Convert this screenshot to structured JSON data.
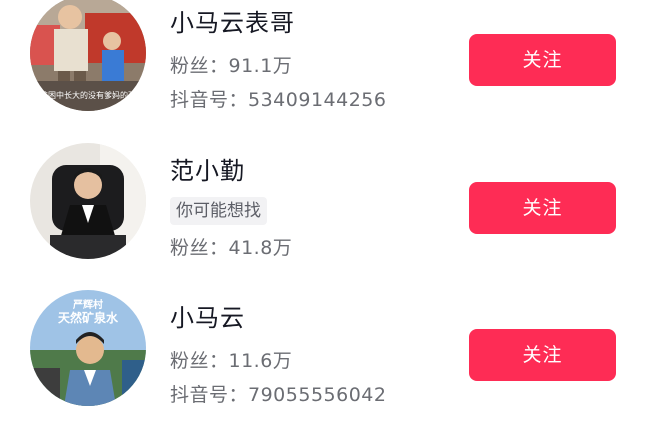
{
  "results": [
    {
      "name": "小马云表哥",
      "fans": "粉丝：91.1万",
      "douyin_id": "抖音号：53409144256",
      "follow_label": "关注"
    },
    {
      "name": "范小勤",
      "tag": "你可能想找",
      "fans": "粉丝：41.8万",
      "follow_label": "关注"
    },
    {
      "name": "小马云",
      "fans": "粉丝：11.6万",
      "douyin_id": "抖音号：79055556042",
      "follow_label": "关注"
    }
  ],
  "avatar_text": {
    "first": "在贫困中长大的没有爹妈的孩子",
    "third_title_1": "严辉村",
    "third_title_2": "天然矿泉水"
  },
  "colors": {
    "accent": "#fe2c55",
    "primary_text": "#161823",
    "secondary_text": "#6b6d73"
  }
}
